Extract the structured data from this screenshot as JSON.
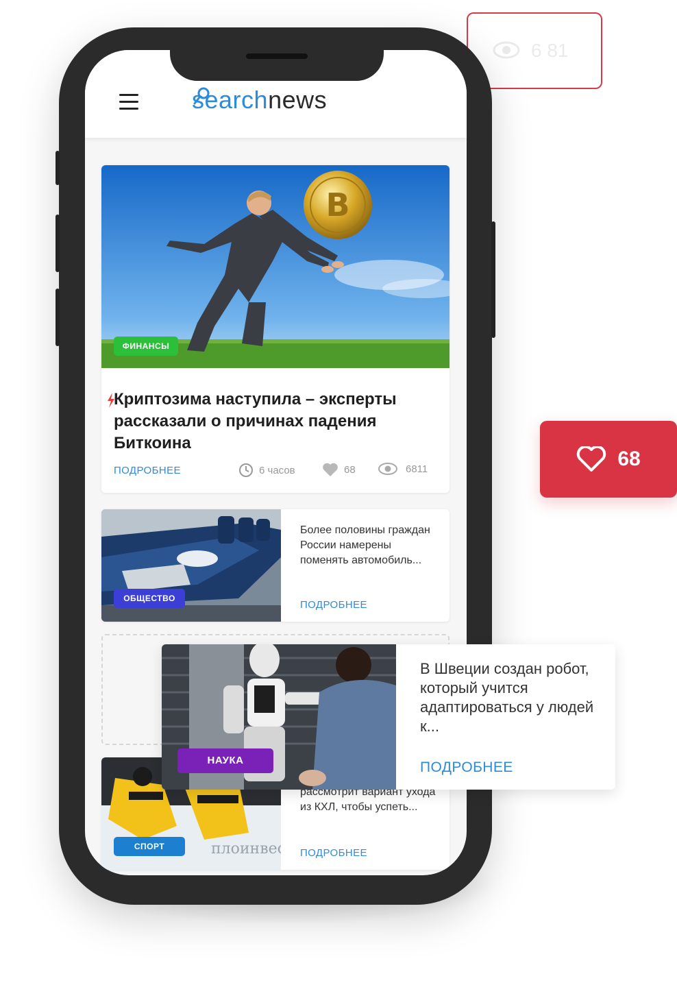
{
  "header": {
    "logo_part1": "search",
    "logo_part2": "news"
  },
  "featured": {
    "category": "ФИНАНСЫ",
    "category_color": "#2bbf3a",
    "title": "Криптозима наступила – эксперты рассказали о причинах падения Биткоина",
    "more_label": "ПОДРОБНЕЕ",
    "time": "6 часов",
    "likes": "68",
    "views": "6811"
  },
  "articles": [
    {
      "category": "ОБЩЕСТВО",
      "category_color": "#3b3fd6",
      "title": "Более половины граждан России намерены поменять автомобиль...",
      "more_label": "ПОДРОБНЕЕ"
    },
    {
      "category": "НАУКА",
      "category_color": "#7a22b8",
      "title": "В Швеции создан робот, который учится адаптироваться у людей к...",
      "more_label": "ПОДРОБНЕЕ"
    },
    {
      "category": "СПОРТ",
      "category_color": "#1d7fd0",
      "title": "рассмотрит вариант ухода из КХЛ, чтобы успеть...",
      "more_label": "ПОДРОБНЕЕ"
    }
  ],
  "like_badge": {
    "count": "68",
    "color": "#d83444"
  },
  "ghost_card": {
    "views": "6 81"
  },
  "colors": {
    "accent": "#2d8bd8",
    "phone_frame": "#2b2b2c"
  }
}
